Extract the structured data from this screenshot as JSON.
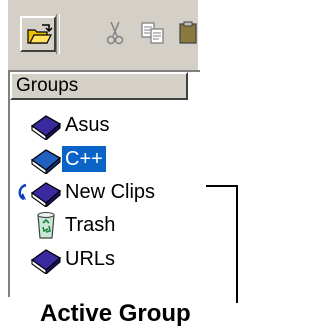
{
  "toolbar": {
    "buttons": [
      {
        "icon": "open-folder-icon"
      },
      {
        "icon": "cut-icon"
      },
      {
        "icon": "copy-icon"
      },
      {
        "icon": "paste-icon"
      }
    ]
  },
  "groups_panel": {
    "header": "Groups",
    "items": [
      {
        "label": "Asus",
        "icon": "book-icon",
        "selected": false
      },
      {
        "label": "C++",
        "icon": "book-icon",
        "selected": true
      },
      {
        "label": "New Clips",
        "icon": "book-icon",
        "selected": false,
        "marker": "active-group-arrow-icon"
      },
      {
        "label": "Trash",
        "icon": "recycle-bin-icon",
        "selected": false
      },
      {
        "label": "URLs",
        "icon": "book-icon",
        "selected": false
      }
    ]
  },
  "annotation": {
    "caption": "Active Group"
  },
  "colors": {
    "selection": "#0a64c8",
    "chrome": "#d4d0c8",
    "book_purple": "#2a1a8a"
  }
}
